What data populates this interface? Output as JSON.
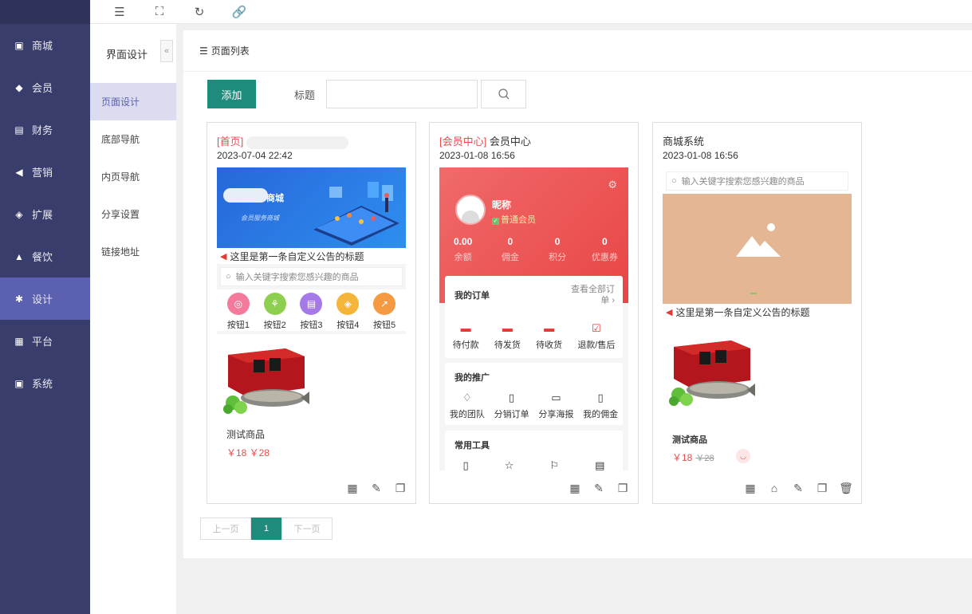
{
  "toolbar": {
    "icons": [
      "menu-fold-icon",
      "fullscreen-icon",
      "refresh-icon",
      "link-icon"
    ],
    "glyphs": [
      "☰",
      "⛶",
      "↻",
      "🔗"
    ]
  },
  "sidebar": {
    "items": [
      {
        "label": "商城",
        "icon": "store-icon",
        "glyph": "▣"
      },
      {
        "label": "会员",
        "icon": "member-icon",
        "glyph": "◆"
      },
      {
        "label": "财务",
        "icon": "finance-icon",
        "glyph": "▤"
      },
      {
        "label": "营销",
        "icon": "megaphone-icon",
        "glyph": "◀"
      },
      {
        "label": "扩展",
        "icon": "cube-icon",
        "glyph": "◈"
      },
      {
        "label": "餐饮",
        "icon": "dining-icon",
        "glyph": "▲"
      },
      {
        "label": "设计",
        "icon": "design-icon",
        "glyph": "✱"
      },
      {
        "label": "平台",
        "icon": "grid-icon",
        "glyph": "▦"
      },
      {
        "label": "系统",
        "icon": "system-icon",
        "glyph": "▣"
      }
    ],
    "active_index": 6
  },
  "subnav": {
    "title": "界面设计",
    "collapse": "«",
    "items": [
      "页面设计",
      "底部导航",
      "内页导航",
      "分享设置",
      "链接地址"
    ]
  },
  "main": {
    "title": "页面列表",
    "add_label": "添加",
    "search_label": "标题",
    "search_value": "",
    "search_icon": "search-icon"
  },
  "cards": [
    {
      "tag": "[首页]",
      "name": "",
      "date": "2023-07-04 22:42",
      "banner_title": "商城",
      "banner_sub": "会员服务商城",
      "notice": "这里是第一条自定义公告的标题",
      "search_placeholder": "输入关键字搜索您感兴趣的商品",
      "buttons": [
        "按钮1",
        "按钮2",
        "按钮3",
        "按钮4",
        "按钮5"
      ],
      "product_name": "测试商品",
      "product_price": "￥18  ￥28"
    },
    {
      "tag": "[会员中心]",
      "name": "会员中心",
      "date": "2023-01-08 16:56",
      "nickname": "昵称",
      "level": "普通会员",
      "stats": [
        {
          "value": "0.00",
          "label": "余额"
        },
        {
          "value": "0",
          "label": "佣金"
        },
        {
          "value": "0",
          "label": "积分"
        },
        {
          "value": "0",
          "label": "优惠券"
        }
      ],
      "orders_title": "我的订单",
      "orders_more": "查看全部订单",
      "orders": [
        "待付款",
        "待发货",
        "待收货",
        "退款/售后"
      ],
      "promo_title": "我的推广",
      "promo": [
        "我的团队",
        "分销订单",
        "分享海报",
        "我的佣金"
      ],
      "tools_title": "常用工具"
    },
    {
      "tag": "",
      "name": "商城系统",
      "date": "2023-01-08 16:56",
      "search_placeholder": "输入关键字搜索您感兴趣的商品",
      "notice": "这里是第一条自定义公告的标题",
      "product_name": "测试商品",
      "price": "￥18",
      "old_price": "￥28"
    }
  ],
  "pagination": {
    "prev": "上一页",
    "current": "1",
    "next": "下一页"
  },
  "colors": {
    "sidebar_bg": "#393d6b",
    "sidebar_active": "#5b60b0",
    "accent_green": "#1f8b7c",
    "red": "#e94b4b"
  }
}
